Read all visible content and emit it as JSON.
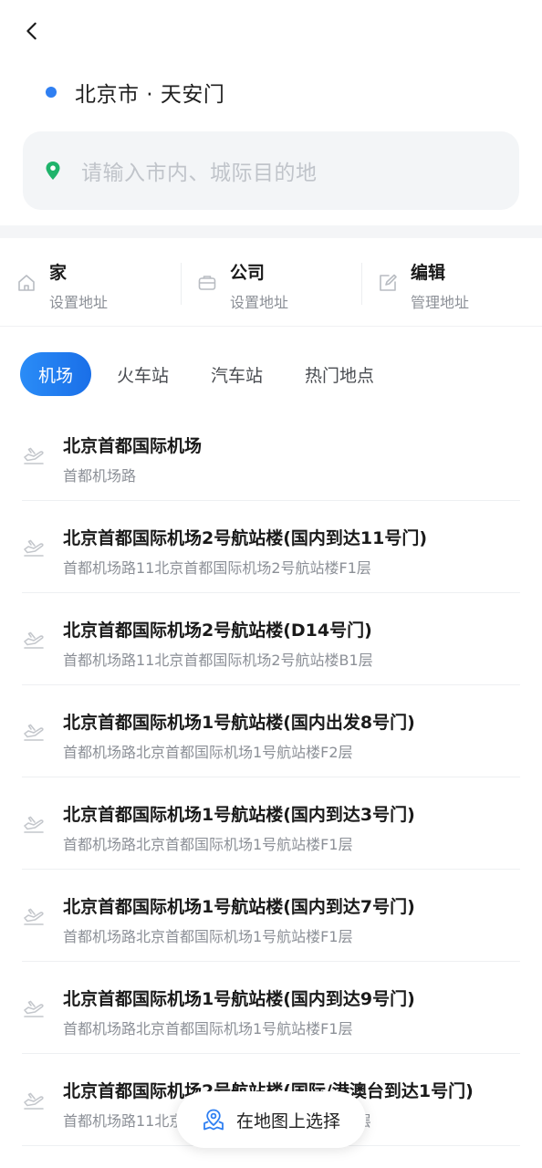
{
  "header": {
    "back_icon": "chevron-left-icon"
  },
  "origin": {
    "text": "北京市 · 天安门",
    "dot_color": "#2f7ff2"
  },
  "search": {
    "placeholder": "请输入市内、城际目的地",
    "icon": "location-pin-icon",
    "icon_color": "#1fb36b"
  },
  "shortcuts": [
    {
      "icon": "home-icon",
      "title": "家",
      "subtitle": "设置地址"
    },
    {
      "icon": "briefcase-icon",
      "title": "公司",
      "subtitle": "设置地址"
    },
    {
      "icon": "edit-icon",
      "title": "编辑",
      "subtitle": "管理地址"
    }
  ],
  "tabs": [
    {
      "label": "机场",
      "active": true
    },
    {
      "label": "火车站",
      "active": false
    },
    {
      "label": "汽车站",
      "active": false
    },
    {
      "label": "热门地点",
      "active": false
    }
  ],
  "places": [
    {
      "icon": "airplane-icon",
      "title": "北京首都国际机场",
      "subtitle": "首都机场路"
    },
    {
      "icon": "airplane-icon",
      "title": "北京首都国际机场2号航站楼(国内到达11号门)",
      "subtitle": "首都机场路11北京首都国际机场2号航站楼F1层"
    },
    {
      "icon": "airplane-icon",
      "title": "北京首都国际机场2号航站楼(D14号门)",
      "subtitle": "首都机场路11北京首都国际机场2号航站楼B1层"
    },
    {
      "icon": "airplane-icon",
      "title": "北京首都国际机场1号航站楼(国内出发8号门)",
      "subtitle": "首都机场路北京首都国际机场1号航站楼F2层"
    },
    {
      "icon": "airplane-icon",
      "title": "北京首都国际机场1号航站楼(国内到达3号门)",
      "subtitle": "首都机场路北京首都国际机场1号航站楼F1层"
    },
    {
      "icon": "airplane-icon",
      "title": "北京首都国际机场1号航站楼(国内到达7号门)",
      "subtitle": "首都机场路北京首都国际机场1号航站楼F1层"
    },
    {
      "icon": "airplane-icon",
      "title": "北京首都国际机场1号航站楼(国内到达9号门)",
      "subtitle": "首都机场路北京首都国际机场1号航站楼F1层"
    },
    {
      "icon": "airplane-icon",
      "title": "北京首都国际机场2号航站楼(国际/港澳台到达1号门)",
      "subtitle": "首都机场路11北京首都国际机场2号航站楼F1层"
    }
  ],
  "map_select": {
    "label": "在地图上选择",
    "icon": "map-pin-icon",
    "icon_color": "#2f7ff2"
  },
  "colors": {
    "accent": "#1a7ff0",
    "muted_text": "#8c9097",
    "placeholder": "#c0c4ca"
  }
}
